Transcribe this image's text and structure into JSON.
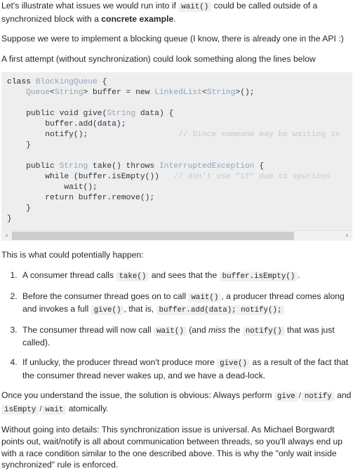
{
  "intro": {
    "p1_a": "Let's illustrate what issues we would run into if ",
    "p1_code": "wait()",
    "p1_b": " could be called outside of a synchronized block with a ",
    "p1_bold": "concrete example",
    "p1_c": ".",
    "p2": "Suppose we were to implement a blocking queue (I know, there is already one in the API :)",
    "p3": "A first attempt (without synchronization) could look something along the lines below"
  },
  "code_block": {
    "language": "java",
    "lines": [
      [
        {
          "t": "class ",
          "c": "kw"
        },
        {
          "t": "BlockingQueue",
          "c": "typ"
        },
        {
          "t": " {",
          "c": "pl"
        }
      ],
      [
        {
          "t": "    ",
          "c": "pl"
        },
        {
          "t": "Queue",
          "c": "typ"
        },
        {
          "t": "<",
          "c": "pl"
        },
        {
          "t": "String",
          "c": "typ"
        },
        {
          "t": "> buffer = new ",
          "c": "pl"
        },
        {
          "t": "LinkedList",
          "c": "typ"
        },
        {
          "t": "<",
          "c": "pl"
        },
        {
          "t": "String",
          "c": "typ"
        },
        {
          "t": ">();",
          "c": "pl"
        }
      ],
      [],
      [
        {
          "t": "    public void give(",
          "c": "pl"
        },
        {
          "t": "String",
          "c": "typ"
        },
        {
          "t": " data) {",
          "c": "pl"
        }
      ],
      [
        {
          "t": "        buffer.add(data);",
          "c": "pl"
        }
      ],
      [
        {
          "t": "        notify();                   ",
          "c": "pl"
        },
        {
          "t": "// Since someone may be waiting in",
          "c": "com"
        }
      ],
      [
        {
          "t": "    }",
          "c": "pl"
        }
      ],
      [],
      [
        {
          "t": "    public ",
          "c": "pl"
        },
        {
          "t": "String",
          "c": "typ"
        },
        {
          "t": " take() throws ",
          "c": "pl"
        },
        {
          "t": "InterruptedException",
          "c": "typ"
        },
        {
          "t": " {",
          "c": "pl"
        }
      ],
      [
        {
          "t": "        while (buffer.isEmpty())   ",
          "c": "pl"
        },
        {
          "t": "// don't use \"if\" due to spurious ",
          "c": "com"
        }
      ],
      [
        {
          "t": "            wait();",
          "c": "pl"
        }
      ],
      [
        {
          "t": "        return buffer.remove();",
          "c": "pl"
        }
      ],
      [
        {
          "t": "    }",
          "c": "pl"
        }
      ],
      [
        {
          "t": "}",
          "c": "pl"
        }
      ]
    ],
    "scrollbar": {
      "left_arrow": "‹",
      "right_arrow": "›",
      "thumb_width_pct": 85.5
    }
  },
  "what_happens": {
    "lead": "This is what could potentially happen:",
    "items": [
      {
        "parts": [
          {
            "type": "text",
            "v": "A consumer thread calls "
          },
          {
            "type": "code",
            "v": "take()"
          },
          {
            "type": "text",
            "v": " and sees that the "
          },
          {
            "type": "code",
            "v": "buffer.isEmpty()"
          },
          {
            "type": "text",
            "v": "."
          }
        ]
      },
      {
        "parts": [
          {
            "type": "text",
            "v": "Before the consumer thread goes on to call "
          },
          {
            "type": "code",
            "v": "wait()"
          },
          {
            "type": "text",
            "v": ", a producer thread comes along and invokes a full "
          },
          {
            "type": "code",
            "v": "give()"
          },
          {
            "type": "text",
            "v": ", that is, "
          },
          {
            "type": "code",
            "v": "buffer.add(data); notify();"
          }
        ]
      },
      {
        "parts": [
          {
            "type": "text",
            "v": "The consumer thread will now call "
          },
          {
            "type": "code",
            "v": "wait()"
          },
          {
            "type": "text",
            "v": " (and "
          },
          {
            "type": "em",
            "v": "miss"
          },
          {
            "type": "text",
            "v": " the "
          },
          {
            "type": "code",
            "v": "notify()"
          },
          {
            "type": "text",
            "v": " that was just called)."
          }
        ]
      },
      {
        "parts": [
          {
            "type": "text",
            "v": "If unlucky, the producer thread won't produce more "
          },
          {
            "type": "code",
            "v": "give()"
          },
          {
            "type": "text",
            "v": " as a result of the fact that the consumer thread never wakes up, and we have a dead-lock."
          }
        ]
      }
    ]
  },
  "solution": {
    "parts": [
      {
        "type": "text",
        "v": "Once you understand the issue, the solution is obvious: Always perform "
      },
      {
        "type": "code",
        "v": "give"
      },
      {
        "type": "sep",
        "v": "/"
      },
      {
        "type": "code",
        "v": "notify"
      },
      {
        "type": "text",
        "v": " and "
      },
      {
        "type": "code",
        "v": "isEmpty"
      },
      {
        "type": "sep",
        "v": "/"
      },
      {
        "type": "code",
        "v": "wait"
      },
      {
        "type": "text",
        "v": " atomically."
      }
    ]
  },
  "closing": {
    "text": "Without going into details: This synchronization issue is universal. As Michael Borgwardt points out, wait/notify is all about communication between threads, so you'll always end up with a race condition similar to the one described above. This is why the \"only wait inside synchronized\" rule is enforced."
  },
  "colors": {
    "page_background": "#ffffff",
    "code_block_background": "#eeeeee",
    "inline_code_background": "#eff0f1",
    "text": "#242729",
    "code_type": "#8aa6c1",
    "code_comment": "#c3c9cd",
    "scrollbar_track": "#f1f1f1",
    "scrollbar_thumb": "#cdcdcd"
  }
}
